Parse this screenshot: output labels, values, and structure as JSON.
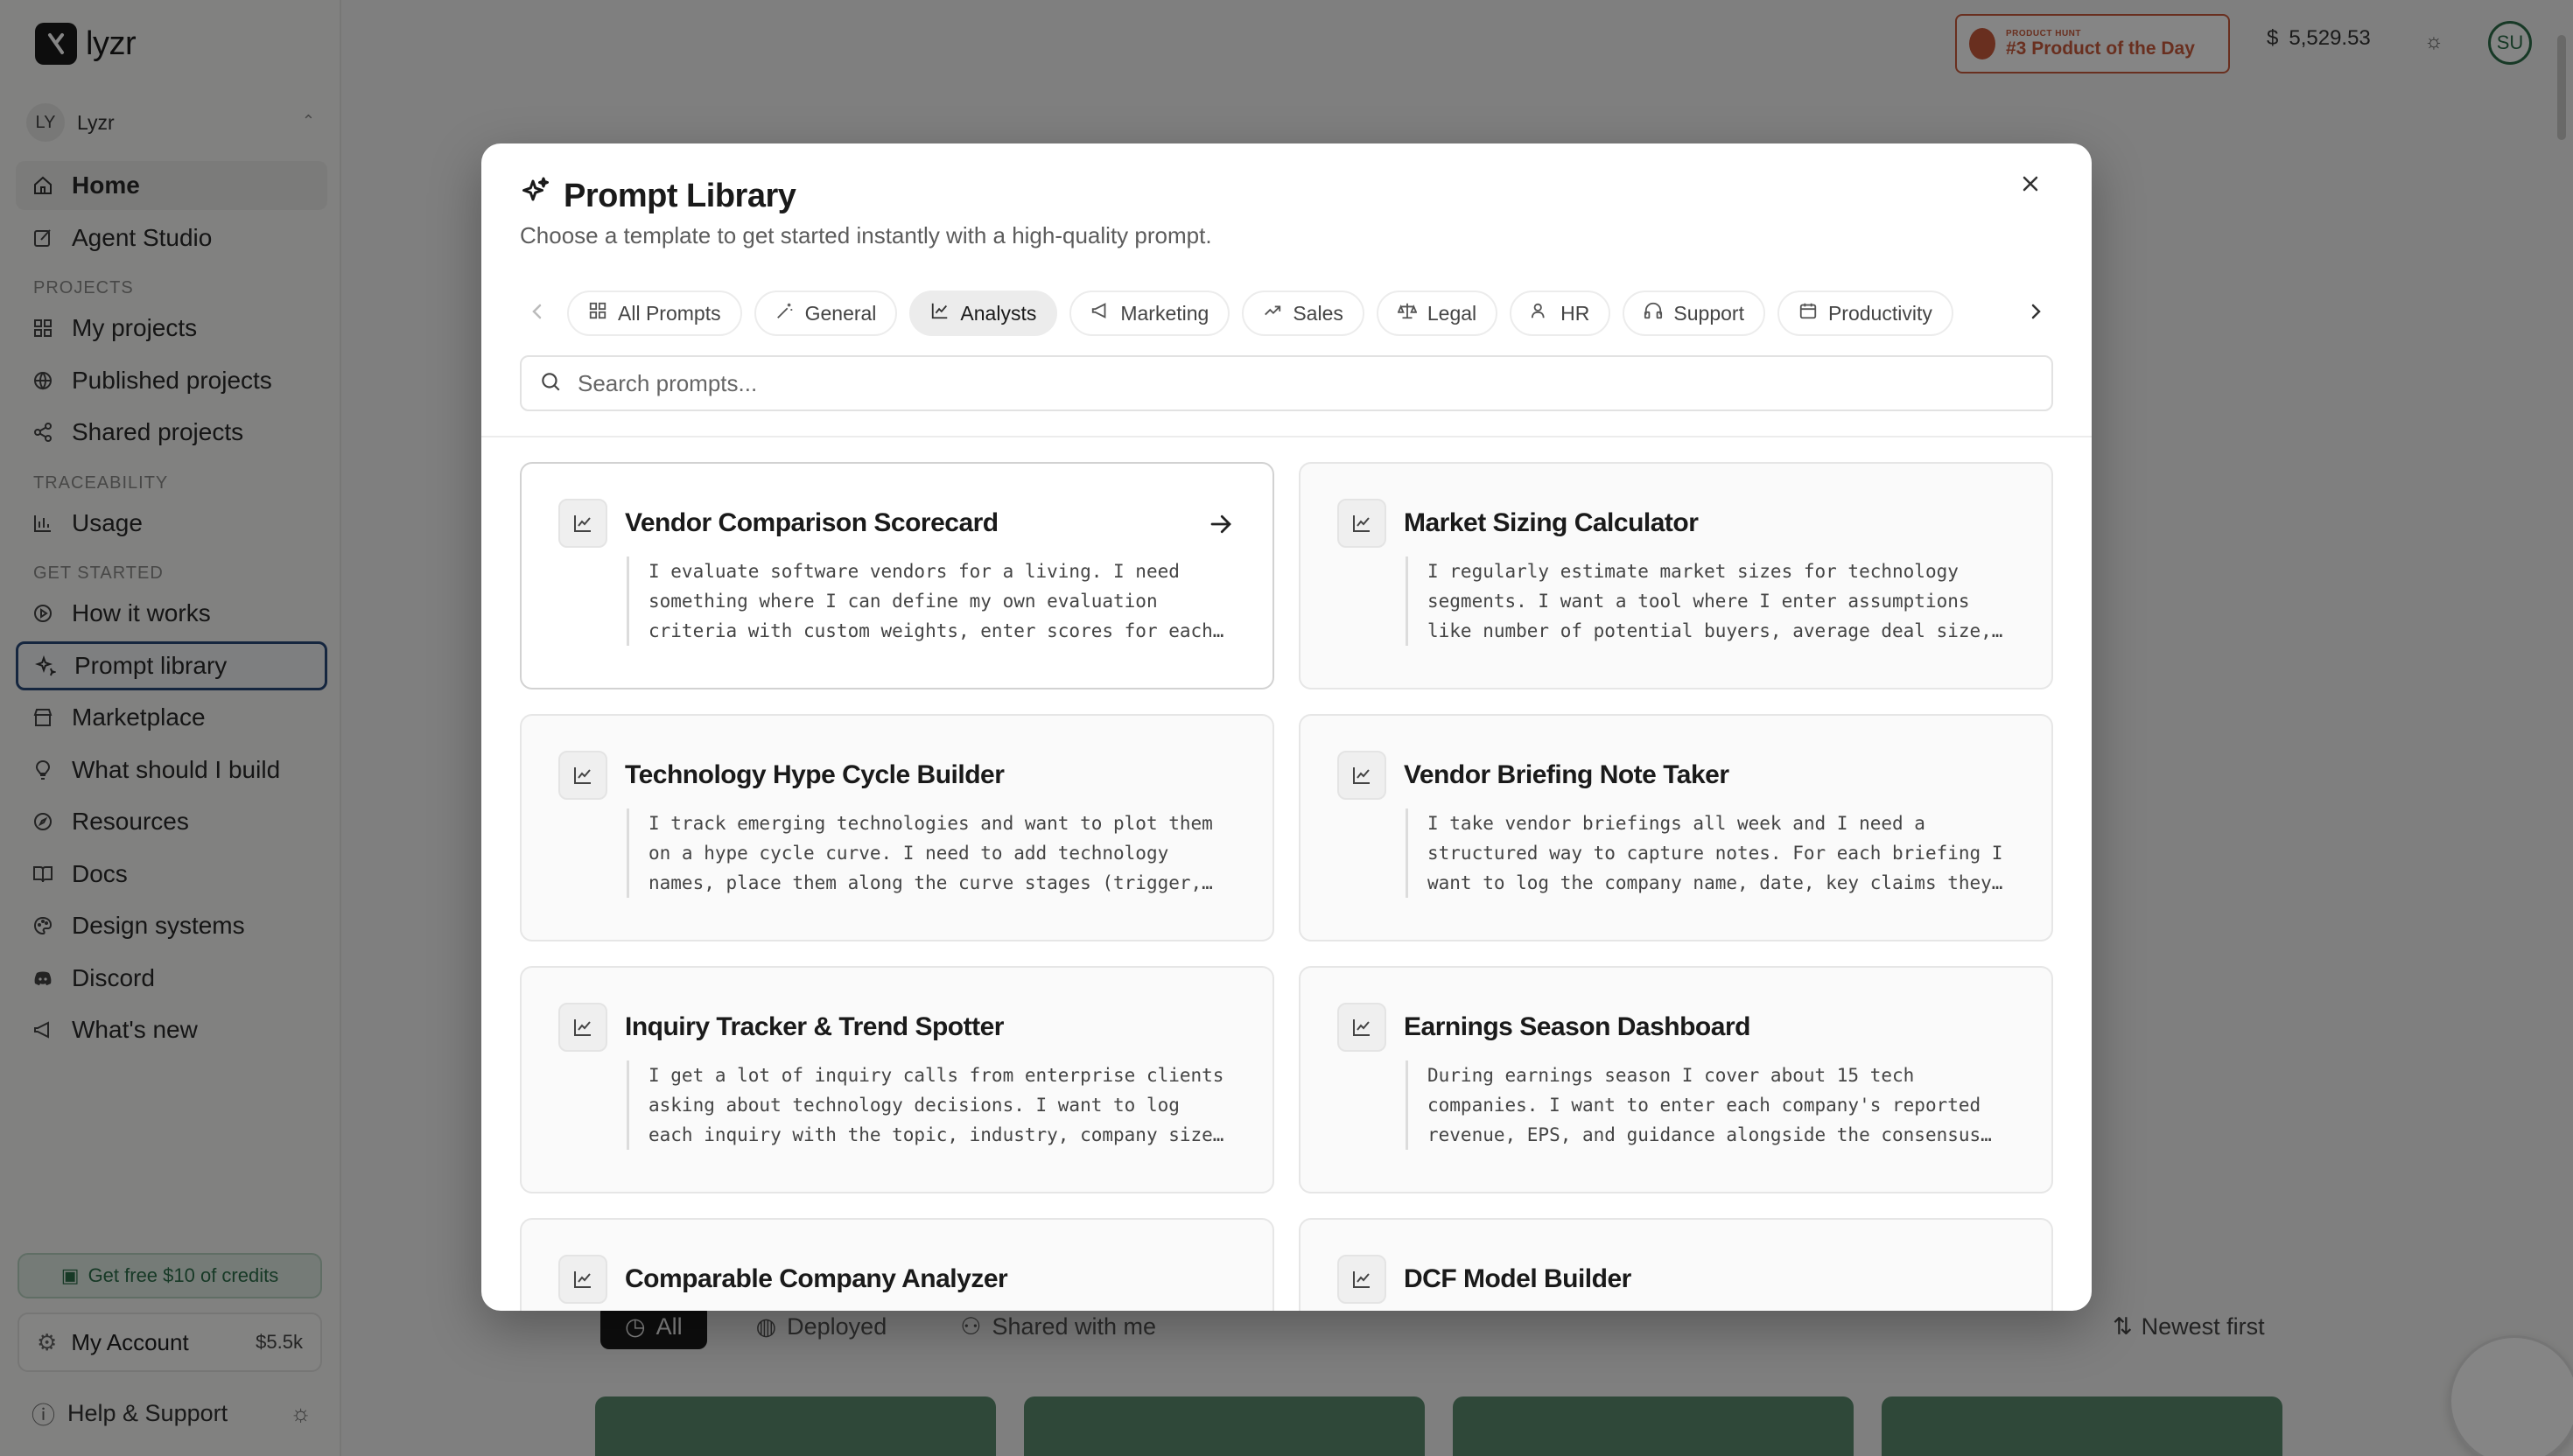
{
  "app": {
    "brand": "lyzr"
  },
  "workspace": {
    "initials": "LY",
    "name": "Lyzr"
  },
  "nav": {
    "main": [
      {
        "label": "Home",
        "icon": "home-icon"
      },
      {
        "label": "Agent Studio",
        "icon": "edit-square-icon"
      }
    ],
    "projects_label": "PROJECTS",
    "projects": [
      {
        "label": "My projects",
        "icon": "grid-icon"
      },
      {
        "label": "Published projects",
        "icon": "globe-icon"
      },
      {
        "label": "Shared projects",
        "icon": "share-icon"
      }
    ],
    "traceability_label": "TRACEABILITY",
    "traceability": [
      {
        "label": "Usage",
        "icon": "bar-chart-icon"
      }
    ],
    "get_started_label": "GET STARTED",
    "get_started": [
      {
        "label": "How it works",
        "icon": "play-circle-icon"
      },
      {
        "label": "Prompt library",
        "icon": "sparkle-icon"
      },
      {
        "label": "Marketplace",
        "icon": "store-icon"
      },
      {
        "label": "What should I build",
        "icon": "lightbulb-icon"
      },
      {
        "label": "Resources",
        "icon": "compass-icon"
      },
      {
        "label": "Docs",
        "icon": "book-icon"
      },
      {
        "label": "Design systems",
        "icon": "palette-icon"
      },
      {
        "label": "Discord",
        "icon": "discord-icon"
      },
      {
        "label": "What's new",
        "icon": "megaphone-icon"
      }
    ]
  },
  "sidebar_footer": {
    "credits_label": "Get free $10 of credits",
    "account_label": "My Account",
    "account_balance": "$5.5k",
    "help_label": "Help & Support"
  },
  "topbar": {
    "badge_small": "PRODUCT HUNT",
    "badge_big": "#3 Product of the Day",
    "balance": "5,529.53",
    "user_initials": "SU"
  },
  "background": {
    "filters": [
      "All",
      "Deployed",
      "Shared with me"
    ],
    "sort_label": "Newest first"
  },
  "modal": {
    "title": "Prompt Library",
    "subtitle": "Choose a template to get started instantly with a high-quality prompt.",
    "tabs": [
      {
        "label": "All Prompts",
        "icon": "grid-icon"
      },
      {
        "label": "General",
        "icon": "wand-icon"
      },
      {
        "label": "Analysts",
        "icon": "line-chart-icon",
        "active": true
      },
      {
        "label": "Marketing",
        "icon": "megaphone-icon"
      },
      {
        "label": "Sales",
        "icon": "trend-up-icon"
      },
      {
        "label": "Legal",
        "icon": "scale-icon"
      },
      {
        "label": "HR",
        "icon": "users-icon"
      },
      {
        "label": "Support",
        "icon": "headphones-icon"
      },
      {
        "label": "Productivity",
        "icon": "calendar-icon"
      }
    ],
    "search_placeholder": "Search prompts...",
    "cards": [
      {
        "title": "Vendor Comparison Scorecard",
        "desc": "I evaluate software vendors for a living. I need something where I can define my own evaluation criteria with custom weights, enter scores for each vendor"
      },
      {
        "title": "Market Sizing Calculator",
        "desc": "I regularly estimate market sizes for technology segments. I want a tool where I enter assumptions like number of potential buyers, average deal size, and"
      },
      {
        "title": "Technology Hype Cycle Builder",
        "desc": "I track emerging technologies and want to plot them on a hype cycle curve. I need to add technology names, place them along the curve stages (trigger, peak"
      },
      {
        "title": "Vendor Briefing Note Taker",
        "desc": "I take vendor briefings all week and I need a structured way to capture notes. For each briefing I want to log the company name, date, key claims they make"
      },
      {
        "title": "Inquiry Tracker & Trend Spotter",
        "desc": "I get a lot of inquiry calls from enterprise clients asking about technology decisions. I want to log each inquiry with the topic, industry, company size, and"
      },
      {
        "title": "Earnings Season Dashboard",
        "desc": "During earnings season I cover about 15 tech companies. I want to enter each company's reported revenue, EPS, and guidance alongside the consensus estimates"
      },
      {
        "title": "Comparable Company Analyzer",
        "desc": ""
      },
      {
        "title": "DCF Model Builder",
        "desc": ""
      }
    ]
  }
}
